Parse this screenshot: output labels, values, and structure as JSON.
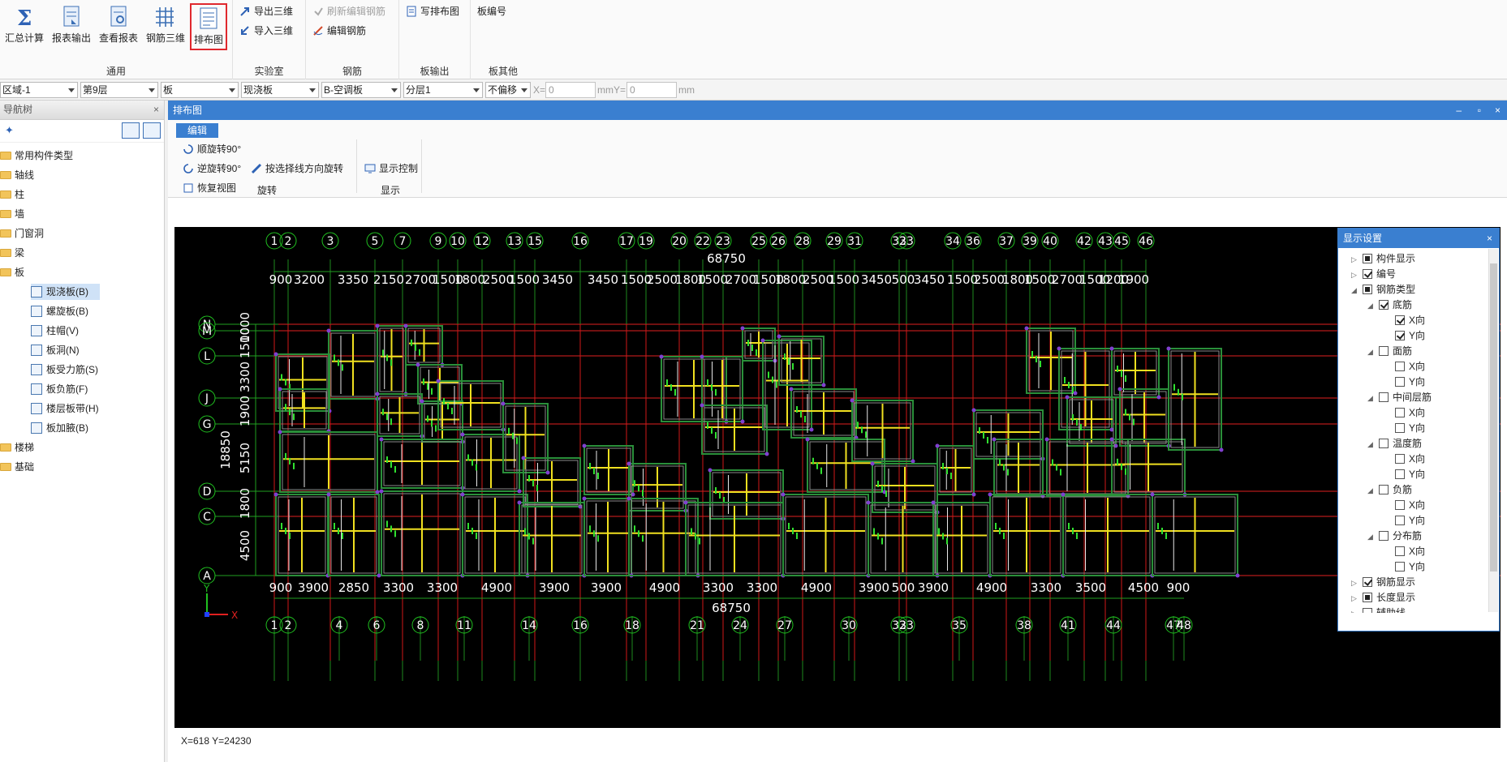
{
  "ribbon": {
    "big_buttons": [
      {
        "label": "汇总计算",
        "icon": "sigma-icon"
      },
      {
        "label": "报表输出",
        "icon": "report-export-icon"
      },
      {
        "label": "查看报表",
        "icon": "report-view-icon"
      },
      {
        "label": "钢筋三维",
        "icon": "rebar-3d-icon"
      },
      {
        "label": "排布图",
        "icon": "layout-drawing-icon"
      }
    ],
    "group_general": "通用",
    "group_lab": "实验室",
    "group_rebar": "钢筋",
    "group_board_out": "板输出",
    "group_board_other": "板其他",
    "export_3d": "导出三维",
    "import_3d": "导入三维",
    "refresh_rebar": "刷新编辑钢筋",
    "edit_rebar": "编辑钢筋",
    "write_layout": "写排布图",
    "board_number": "板编号"
  },
  "filters": {
    "region": "区域-1",
    "floor": "第9层",
    "category": "板",
    "type": "现浇板",
    "component": "B-空调板",
    "layer": "分层1",
    "offset": "不偏移",
    "x_label": "X=",
    "x_value": "0",
    "y_label": "mmY=",
    "y_value": "0",
    "unit": "mm"
  },
  "nav": {
    "title": "导航树",
    "items": [
      "常用构件类型",
      "轴线",
      "柱",
      "墙",
      "门窗洞",
      "梁",
      "板",
      "楼梯",
      "基础"
    ],
    "board_children": [
      "现浇板(B)",
      "螺旋板(B)",
      "柱帽(V)",
      "板洞(N)",
      "板受力筋(S)",
      "板负筋(F)",
      "楼层板带(H)",
      "板加腋(B)"
    ]
  },
  "pane": {
    "title": "排布图",
    "tab": "编辑",
    "rotate_cw": "顺旋转90°",
    "rotate_ccw": "逆旋转90°",
    "restore_view": "恢复视图",
    "rotate_by_line": "按选择线方向旋转",
    "display_control": "显示控制",
    "group_rotate": "旋转",
    "group_display": "显示",
    "status": "X=618 Y=24230"
  },
  "display_panel": {
    "title": "显示设置",
    "rows": [
      {
        "label": "构件显示",
        "level": 0,
        "state": "part",
        "tw": "closed"
      },
      {
        "label": "编号",
        "level": 0,
        "state": "on",
        "tw": "closed"
      },
      {
        "label": "钢筋类型",
        "level": 0,
        "state": "part",
        "tw": "open"
      },
      {
        "label": "底筋",
        "level": 1,
        "state": "on",
        "tw": "open"
      },
      {
        "label": "X向",
        "level": 2,
        "state": "on",
        "tw": ""
      },
      {
        "label": "Y向",
        "level": 2,
        "state": "on",
        "tw": ""
      },
      {
        "label": "面筋",
        "level": 1,
        "state": "off",
        "tw": "open"
      },
      {
        "label": "X向",
        "level": 2,
        "state": "off",
        "tw": ""
      },
      {
        "label": "Y向",
        "level": 2,
        "state": "off",
        "tw": ""
      },
      {
        "label": "中间层筋",
        "level": 1,
        "state": "off",
        "tw": "open"
      },
      {
        "label": "X向",
        "level": 2,
        "state": "off",
        "tw": ""
      },
      {
        "label": "Y向",
        "level": 2,
        "state": "off",
        "tw": ""
      },
      {
        "label": "温度筋",
        "level": 1,
        "state": "off",
        "tw": "open"
      },
      {
        "label": "X向",
        "level": 2,
        "state": "off",
        "tw": ""
      },
      {
        "label": "Y向",
        "level": 2,
        "state": "off",
        "tw": ""
      },
      {
        "label": "负筋",
        "level": 1,
        "state": "off",
        "tw": "open"
      },
      {
        "label": "X向",
        "level": 2,
        "state": "off",
        "tw": ""
      },
      {
        "label": "Y向",
        "level": 2,
        "state": "off",
        "tw": ""
      },
      {
        "label": "分布筋",
        "level": 1,
        "state": "off",
        "tw": "open"
      },
      {
        "label": "X向",
        "level": 2,
        "state": "off",
        "tw": ""
      },
      {
        "label": "Y向",
        "level": 2,
        "state": "off",
        "tw": ""
      },
      {
        "label": "钢筋显示",
        "level": 0,
        "state": "on",
        "tw": "closed"
      },
      {
        "label": "长度显示",
        "level": 0,
        "state": "part",
        "tw": "closed"
      },
      {
        "label": "辅助线",
        "level": 0,
        "state": "off",
        "tw": "closed"
      }
    ]
  },
  "drawing": {
    "top_axes": [
      "1",
      "2",
      "3",
      "5",
      "7",
      "9",
      "10",
      "12",
      "13",
      "15",
      "16",
      "17",
      "19",
      "20",
      "22",
      "23",
      "25",
      "26",
      "28",
      "29",
      "31",
      "32",
      "33",
      "34",
      "36",
      "37",
      "39",
      "40",
      "42",
      "43",
      "45",
      "46"
    ],
    "top_dims": [
      "900",
      "3200",
      "3350",
      "2150",
      "2700",
      "1500",
      "1800",
      "2500",
      "1500",
      "3450",
      "3450",
      "1500",
      "2500",
      "1800",
      "1500",
      "2700",
      "1500",
      "1800",
      "2500",
      "1500",
      "3450",
      "500",
      "3450",
      "1500",
      "2500",
      "1800",
      "1500",
      "2700",
      "1500",
      "1200",
      "1900"
    ],
    "top_total": "68750",
    "bottom_axes": [
      "1",
      "2",
      "4",
      "6",
      "8",
      "11",
      "14",
      "16",
      "18",
      "21",
      "24",
      "27",
      "30",
      "32",
      "33",
      "35",
      "38",
      "41",
      "44",
      "47",
      "48"
    ],
    "bottom_dims": [
      "900",
      "3900",
      "2850",
      "3300",
      "3300",
      "4900",
      "3900",
      "3900",
      "4900",
      "3300",
      "3300",
      "4900",
      "3900",
      "500",
      "3900",
      "4900",
      "3300",
      "3500",
      "4500",
      "900"
    ],
    "bottom_total": "68750",
    "left_axes": [
      "N",
      "M",
      "L",
      "J",
      "G",
      "D",
      "C",
      "A"
    ],
    "left_dims": [
      "1000",
      "1500",
      "3300",
      "1900",
      "5150",
      "1800",
      "4500"
    ],
    "left_total": "18850",
    "x_axis": "X",
    "y_axis": "Y"
  }
}
